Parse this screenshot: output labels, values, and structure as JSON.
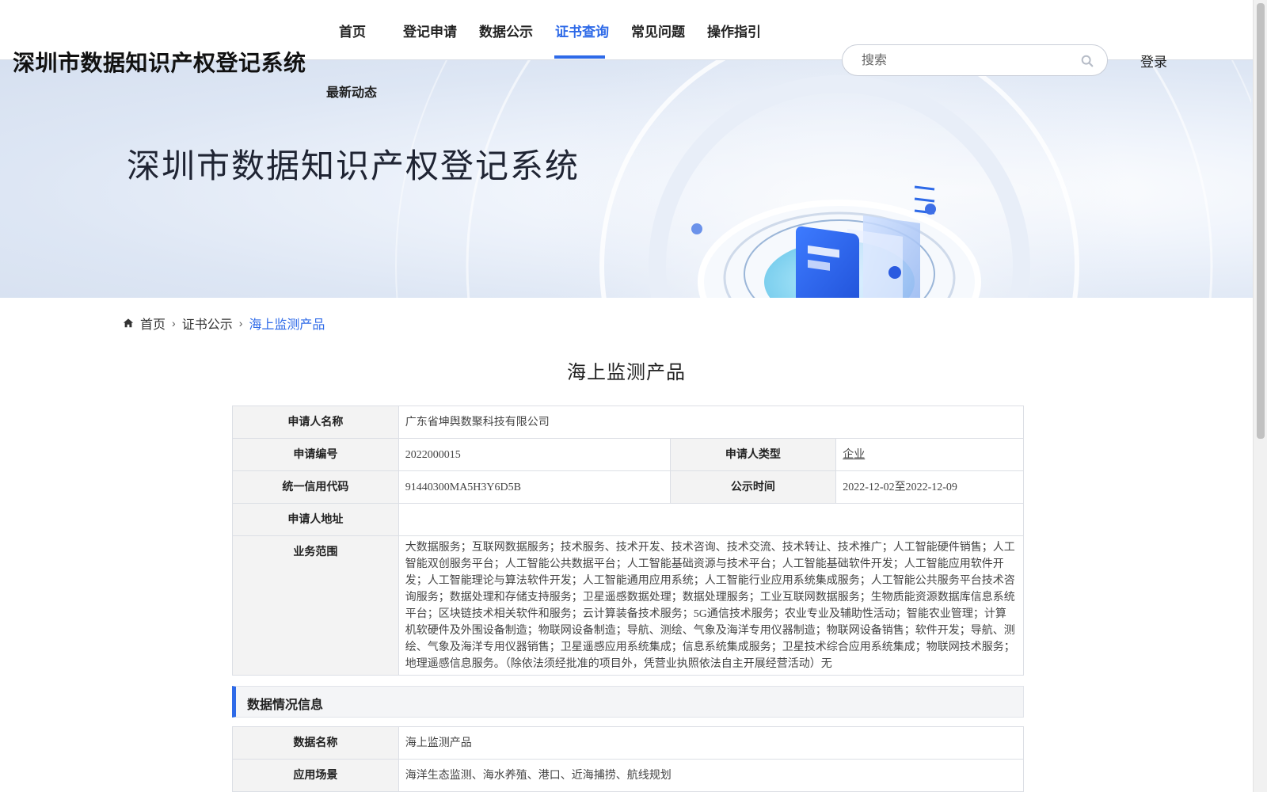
{
  "site": {
    "title": "深圳市数据知识产权登记系统"
  },
  "nav": {
    "items": [
      "首页",
      "登记申请",
      "数据公示",
      "证书查询",
      "常见问题",
      "操作指引"
    ],
    "extra": "最新动态",
    "active_index": 3
  },
  "search": {
    "placeholder": "搜索"
  },
  "auth": {
    "login": "登录"
  },
  "banner": {
    "title": "深圳市数据知识产权登记系统"
  },
  "breadcrumb": {
    "home": "首页",
    "level2": "证书公示",
    "current": "海上监测产品"
  },
  "page": {
    "heading": "海上监测产品"
  },
  "applicant": {
    "name_label": "申请人名称",
    "name": "广东省坤舆数聚科技有限公司",
    "no_label": "申请编号",
    "no": "2022000015",
    "type_label": "申请人类型",
    "type": "企业",
    "credit_label": "统一信用代码",
    "credit": "91440300MA5H3Y6D5B",
    "period_label": "公示时间",
    "period": "2022-12-02至2022-12-09",
    "address_label": "申请人地址",
    "address": "",
    "scope_label": "业务范围",
    "scope": "大数据服务；互联网数据服务；技术服务、技术开发、技术咨询、技术交流、技术转让、技术推广；人工智能硬件销售；人工智能双创服务平台；人工智能公共数据平台；人工智能基础资源与技术平台；人工智能基础软件开发；人工智能应用软件开发；人工智能理论与算法软件开发；人工智能通用应用系统；人工智能行业应用系统集成服务；人工智能公共服务平台技术咨询服务；数据处理和存储支持服务；卫星遥感数据处理；数据处理服务；工业互联网数据服务；生物质能资源数据库信息系统平台；区块链技术相关软件和服务；云计算装备技术服务；5G通信技术服务；农业专业及辅助性活动；智能农业管理；计算机软硬件及外围设备制造；物联网设备制造；导航、测绘、气象及海洋专用仪器制造；物联网设备销售；软件开发；导航、测绘、气象及海洋专用仪器销售；卫星遥感应用系统集成；信息系统集成服务；卫星技术综合应用系统集成；物联网技术服务；地理遥感信息服务。（除依法须经批准的项目外，凭营业执照依法自主开展经营活动）无"
  },
  "data_section": {
    "title": "数据情况信息",
    "name_label": "数据名称",
    "name": "海上监测产品",
    "scene_label": "应用场景",
    "scene": "海洋生态监测、海水养殖、港口、近海捕捞、航线规划"
  },
  "colors": {
    "accent": "#2e6ae8",
    "label_bg": "#f3f3f3",
    "border": "#dcdfe5"
  },
  "icons": [
    "search-icon",
    "home-icon",
    "chevron-right-icon"
  ]
}
